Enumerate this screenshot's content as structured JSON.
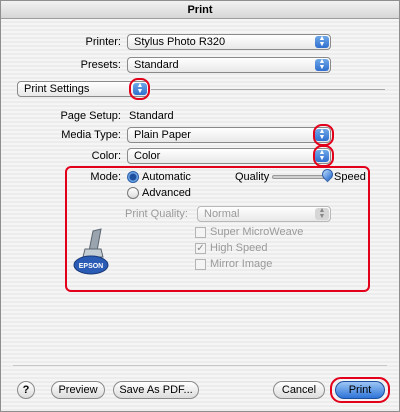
{
  "window": {
    "title": "Print"
  },
  "printer": {
    "label": "Printer:",
    "value": "Stylus Photo R320"
  },
  "presets": {
    "label": "Presets:",
    "value": "Standard"
  },
  "pane": {
    "value": "Print Settings"
  },
  "page_setup": {
    "label": "Page Setup:",
    "value": "Standard"
  },
  "media_type": {
    "label": "Media Type:",
    "value": "Plain Paper"
  },
  "color": {
    "label": "Color:",
    "value": "Color"
  },
  "mode": {
    "label": "Mode:",
    "options": [
      {
        "label": "Automatic",
        "selected": true
      },
      {
        "label": "Advanced",
        "selected": false
      }
    ]
  },
  "quality_slider": {
    "left_label": "Quality",
    "right_label": "Speed",
    "level": 1.0
  },
  "print_quality": {
    "label": "Print Quality:",
    "value": "Normal"
  },
  "checkboxes": [
    {
      "label": "Super MicroWeave",
      "checked": false
    },
    {
      "label": "High Speed",
      "checked": true
    },
    {
      "label": "Mirror Image",
      "checked": false
    }
  ],
  "logo": {
    "text": "EPSON"
  },
  "buttons": {
    "help": "?",
    "preview": "Preview",
    "save_pdf": "Save As PDF...",
    "cancel": "Cancel",
    "print": "Print"
  },
  "colors": {
    "highlight": "#e2001a",
    "accent": "#2e74d8"
  }
}
